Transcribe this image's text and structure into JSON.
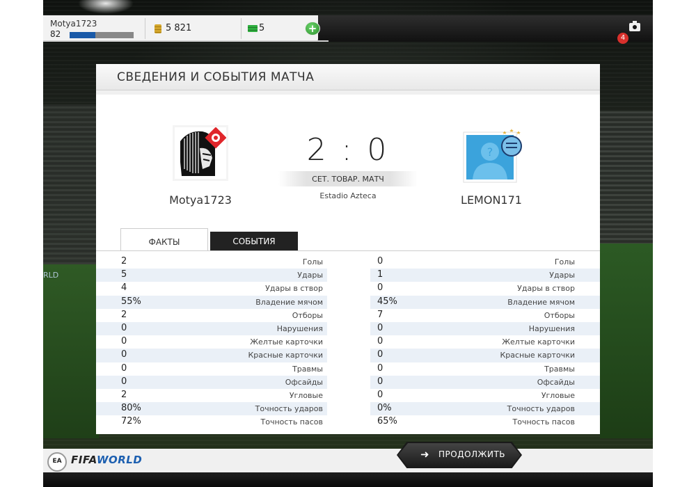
{
  "topbar": {
    "player_name": "Motya1723",
    "player_level": "82",
    "xp_progress": 0.4,
    "coins": "5 821",
    "cash": "5",
    "add_cash_label": "+",
    "notification_count": "4"
  },
  "panel": {
    "title": "СВЕДЕНИЯ И СОБЫТИЯ МАТЧА"
  },
  "match": {
    "home_team": "Motya1723",
    "away_team": "LEMON171",
    "score": "2 : 0",
    "match_type": "СЕТ. ТОВАР. МАТЧ",
    "stadium": "Estadio Azteca"
  },
  "tabs": {
    "facts": "ФАКТЫ",
    "events": "СОБЫТИЯ"
  },
  "stats": [
    {
      "label": "Голы",
      "home": "2",
      "away": "0"
    },
    {
      "label": "Удары",
      "home": "5",
      "away": "1"
    },
    {
      "label": "Удары в створ",
      "home": "4",
      "away": "0"
    },
    {
      "label": "Владение мячом",
      "home": "55%",
      "away": "45%"
    },
    {
      "label": "Отборы",
      "home": "2",
      "away": "7"
    },
    {
      "label": "Нарушения",
      "home": "0",
      "away": "0"
    },
    {
      "label": "Желтые карточки",
      "home": "0",
      "away": "0"
    },
    {
      "label": "Красные карточки",
      "home": "0",
      "away": "0"
    },
    {
      "label": "Травмы",
      "home": "0",
      "away": "0"
    },
    {
      "label": "Офсайды",
      "home": "0",
      "away": "0"
    },
    {
      "label": "Угловые",
      "home": "2",
      "away": "0"
    },
    {
      "label": "Точность ударов",
      "home": "80%",
      "away": "0%"
    },
    {
      "label": "Точность пасов",
      "home": "72%",
      "away": "65%"
    }
  ],
  "bottombar": {
    "ea_logo": "EA",
    "brand_fifa": "FIFA",
    "brand_world": "WORLD",
    "continue_label": "ПРОДОЛЖИТЬ",
    "continue_icon": "arrow-right-icon"
  },
  "background": {
    "board_text": "RLD"
  },
  "colors": {
    "accent_blue": "#1a5aa8",
    "badge_red": "#d8302c",
    "cash_green": "#2fae3f"
  }
}
